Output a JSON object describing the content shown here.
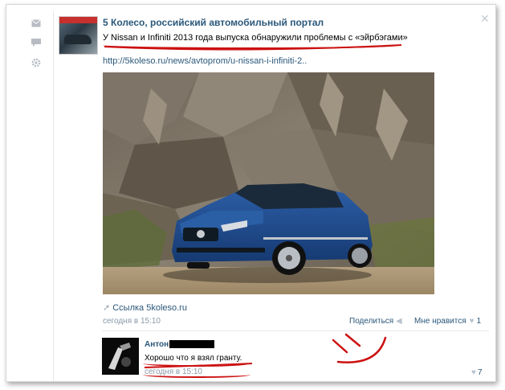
{
  "post": {
    "author": "5 Колесо, российский автомобильный портал",
    "title": "У Nissan и Infiniti 2013 года выпуска обнаружили проблемы с «эйрбэгами»",
    "link_url": "http://5koleso.ru/news/avtoprom/u-nissan-i-infiniti-2..",
    "source_link": "Ссылка 5koleso.ru",
    "date": "сегодня в 15:10",
    "share_label": "Поделиться",
    "like_label": "Мне нравится",
    "like_count": "1"
  },
  "comment": {
    "author": "Антон",
    "text": "Хорошо что я взял гранту.",
    "date": "сегодня в 15:10",
    "like_count": "7"
  },
  "icons": {
    "left_rail": [
      "mail-icon",
      "comment-icon",
      "gear-icon"
    ],
    "close": "close-icon",
    "source_arrow": "arrow-icon",
    "share": "megaphone-icon",
    "like": "heart-icon"
  },
  "colors": {
    "link": "#2b587a",
    "meta": "#8a9aa8",
    "annotation": "#cc1111"
  }
}
